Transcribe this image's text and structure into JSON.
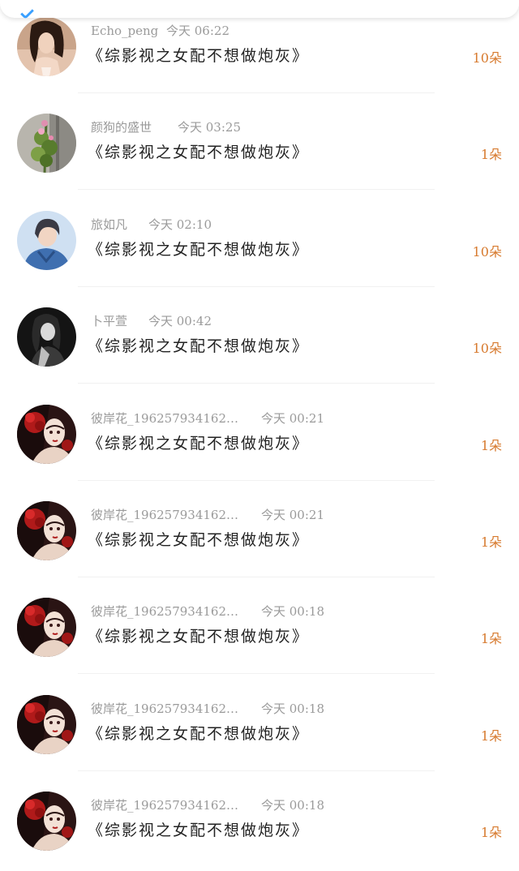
{
  "rows": [
    {
      "username": "Echo_peng",
      "time": "今天 06:22",
      "book": "《综影视之女配不想做炮灰》",
      "gift": "10朵",
      "avatar": "avatar-woman-photo"
    },
    {
      "username": "颜狗的盛世",
      "time": "今天 03:25",
      "book": "《综影视之女配不想做炮灰》",
      "gift": "1朵",
      "avatar": "avatar-flowers"
    },
    {
      "username": "旅如凡",
      "time": "今天 02:10",
      "book": "《综影视之女配不想做炮灰》",
      "gift": "10朵",
      "avatar": "avatar-man-denim"
    },
    {
      "username": "卜平萱",
      "time": "今天 00:42",
      "book": "《综影视之女配不想做炮灰》",
      "gift": "10朵",
      "avatar": "avatar-bw-woman"
    },
    {
      "username": "彼岸花_196257934162…",
      "time": "今天 00:21",
      "book": "《综影视之女配不想做炮灰》",
      "gift": "1朵",
      "avatar": "avatar-red-flower-art"
    },
    {
      "username": "彼岸花_196257934162…",
      "time": "今天 00:21",
      "book": "《综影视之女配不想做炮灰》",
      "gift": "1朵",
      "avatar": "avatar-red-flower-art"
    },
    {
      "username": "彼岸花_196257934162…",
      "time": "今天 00:18",
      "book": "《综影视之女配不想做炮灰》",
      "gift": "1朵",
      "avatar": "avatar-red-flower-art"
    },
    {
      "username": "彼岸花_196257934162…",
      "time": "今天 00:18",
      "book": "《综影视之女配不想做炮灰》",
      "gift": "1朵",
      "avatar": "avatar-red-flower-art"
    },
    {
      "username": "彼岸花_196257934162…",
      "time": "今天 00:18",
      "book": "《综影视之女配不想做炮灰》",
      "gift": "1朵",
      "avatar": "avatar-red-flower-art"
    }
  ],
  "colors": {
    "meta_text": "#9a9a9a",
    "book_text": "#222222",
    "gift_text": "#d77a2e",
    "accent_blue": "#3aa0ff"
  }
}
